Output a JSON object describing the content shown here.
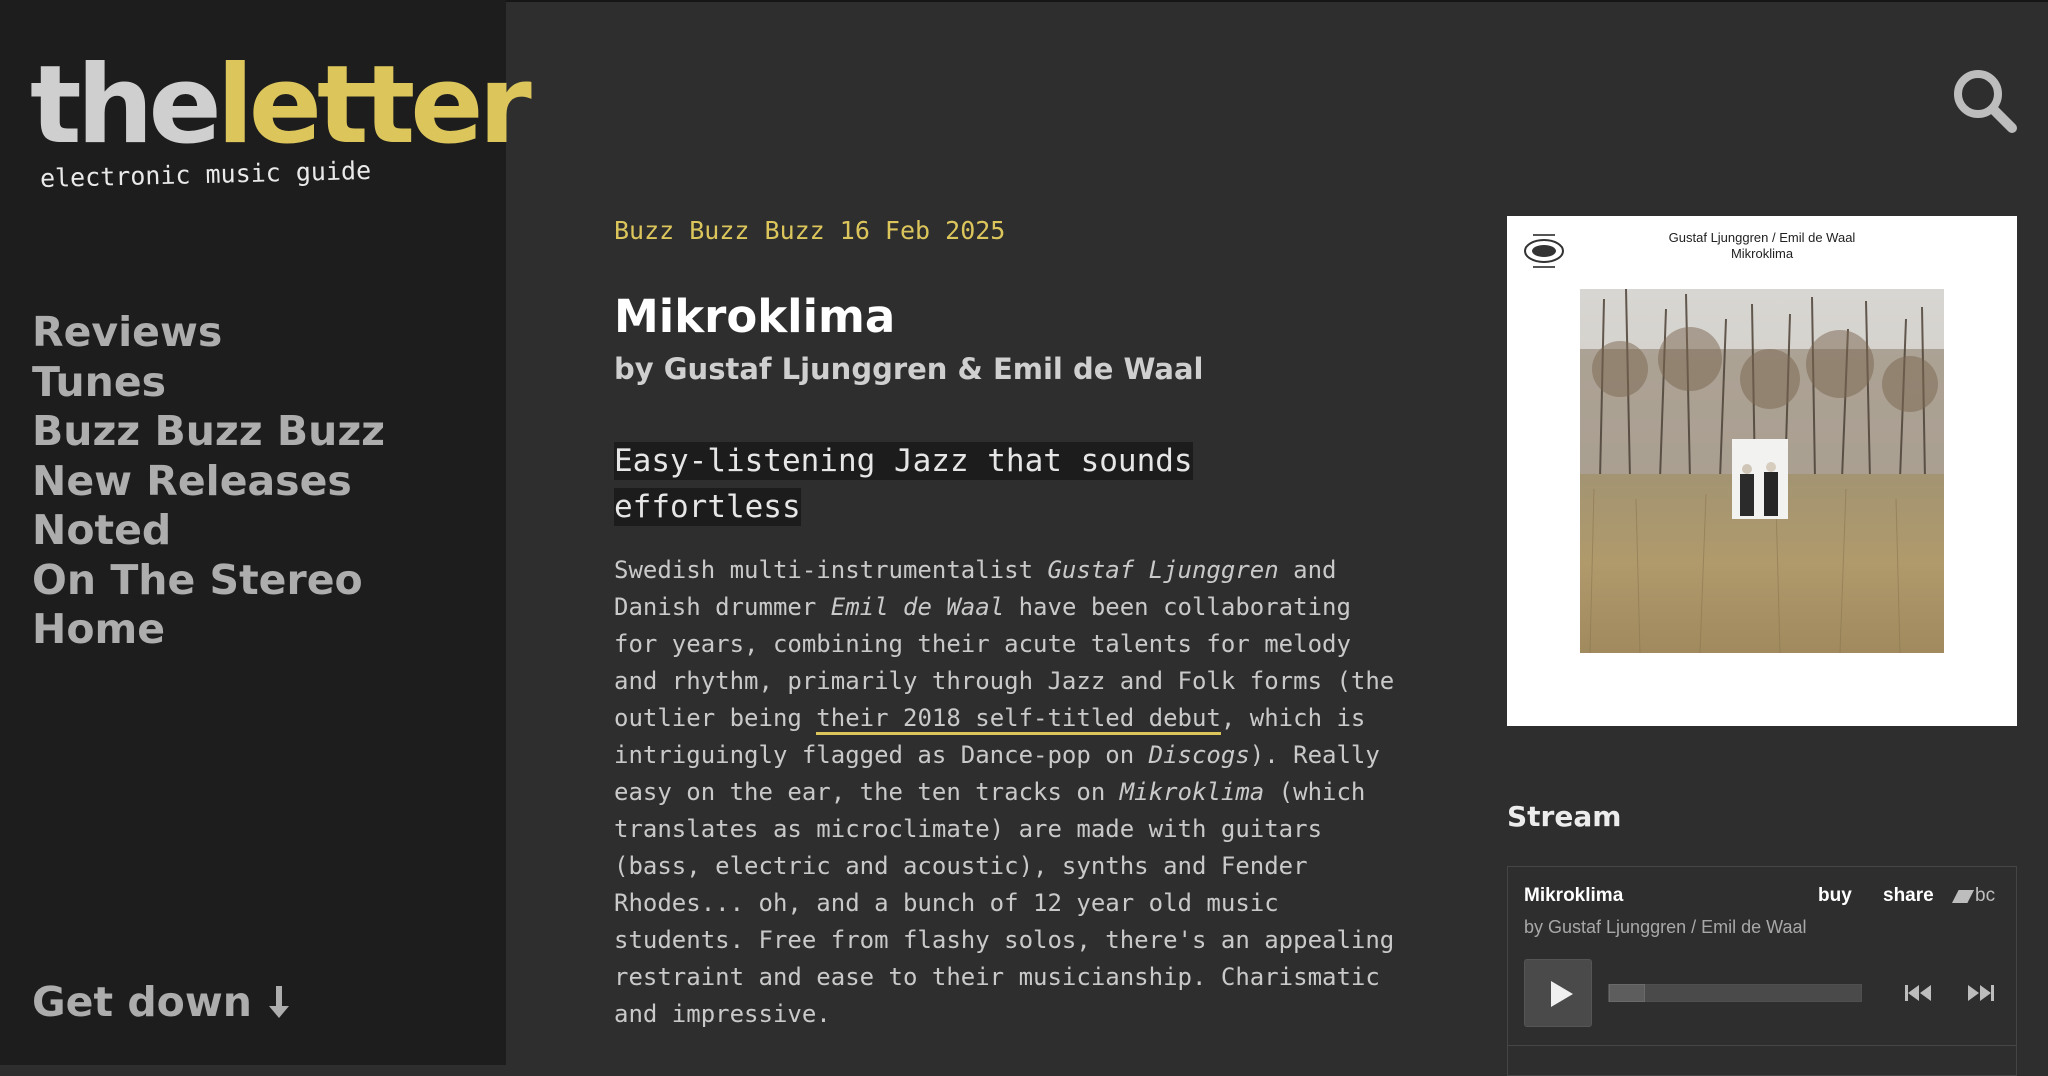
{
  "site": {
    "logo_the": "the",
    "logo_letter": "letter",
    "tagline": "electronic music guide"
  },
  "nav": {
    "items": [
      "Reviews",
      "Tunes",
      "Buzz Buzz Buzz",
      "New Releases",
      "Noted",
      "On The Stereo",
      "Home"
    ],
    "get_down": "Get down"
  },
  "article": {
    "category": "Buzz Buzz Buzz",
    "date": "16 Feb 2025",
    "title": "Mikroklima",
    "byline": "by Gustaf Ljunggren & Emil de Waal",
    "subhead": "Easy-listening Jazz that sounds effortless",
    "body": {
      "t1": "Swedish multi-instrumentalist ",
      "artist1": "Gustaf Ljunggren",
      "t2": " and Danish drummer ",
      "artist2": "Emil de Waal",
      "t3": " have been collaborating for years, combining their acute talents for melody and rhythm, primarily through Jazz and Folk forms (the outlier being ",
      "link": "their 2018 self-titled debut",
      "t4": ", which is intriguingly flagged as Dance-pop on ",
      "discogs": "Discogs",
      "t5": "). Really easy on the ear, the ten tracks on ",
      "album": "Mikroklima",
      "t6": " (which translates as microclimate) are made with guitars (bass, electric and acoustic), synths and Fender Rhodes... oh, and a bunch of 12 year old music students. Free from flashy solos, there's an appealing restraint and ease to their musicianship. Charismatic and impressive."
    }
  },
  "cover": {
    "artist_line": "Gustaf Ljunggren / Emil de Waal",
    "album_line": "Mikroklima"
  },
  "stream": {
    "heading": "Stream",
    "player": {
      "album": "Mikroklima",
      "artist": "by Gustaf Ljunggren / Emil de Waal",
      "buy": "buy",
      "share": "share",
      "bc": "bc",
      "progress": 0
    }
  },
  "colors": {
    "accent": "#dcc65c",
    "sidebar_bg": "#1d1d1d",
    "page_bg": "#2e2e2e",
    "nav_text": "#adadad"
  },
  "icons": {
    "search": "search-icon",
    "arrow": "arrow-down-icon",
    "play": "play-icon",
    "prev": "previous-track-icon",
    "next": "next-track-icon"
  }
}
